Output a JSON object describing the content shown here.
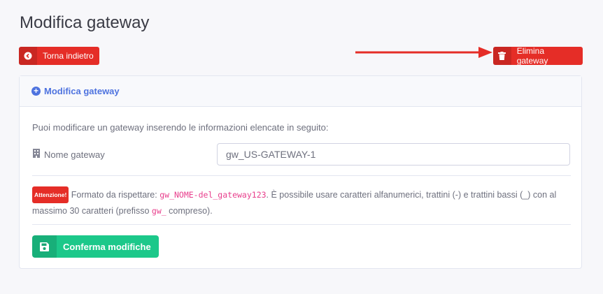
{
  "page": {
    "title": "Modifica gateway"
  },
  "toolbar": {
    "back_label": "Torna indietro",
    "delete_label": "Elimina gateway",
    "back_icon": "arrow-left-circle-icon",
    "delete_icon": "trash-icon",
    "danger_color": "#e52d27"
  },
  "card": {
    "header_title": "Modifica gateway",
    "header_icon": "plus-circle-icon",
    "intro": "Puoi modificare un gateway inserendo le informazioni elencate in seguito:",
    "field_label": "Nome gateway",
    "field_icon": "building-icon",
    "field_value": "gw_US-GATEWAY-1",
    "note": {
      "badge": "Attenzione!",
      "text1": "Formato da rispettare: ",
      "code1": "gw_NOME-del_gateway123",
      "text2": ". È possibile usare caratteri alfanumerici, trattini (-) e trattini bassi (_) con al massimo 30 caratteri (prefisso ",
      "code2": "gw_",
      "text3": " compreso)."
    },
    "confirm_label": "Conferma modifiche",
    "confirm_icon": "save-icon",
    "accent_color": "#4e73df",
    "success_color": "#1cc88a"
  }
}
